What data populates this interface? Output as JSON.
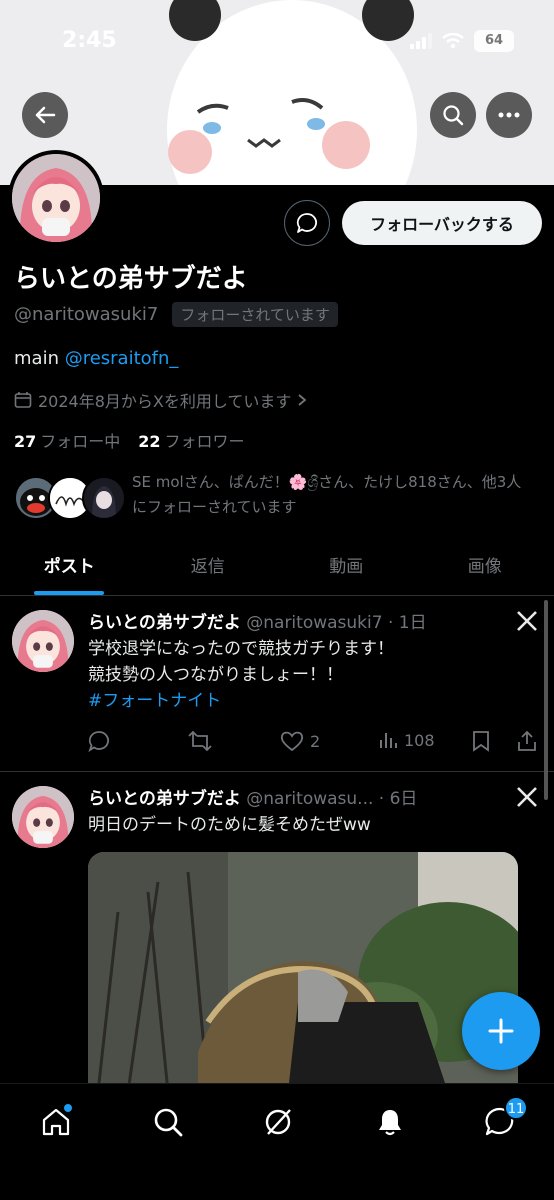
{
  "status_bar": {
    "time": "2:45",
    "battery": "64"
  },
  "profile": {
    "display_name": "らいとの弟サブだよ",
    "handle": "@naritowasuki7",
    "follows_you": "フォローされています",
    "bio_text": "main ",
    "bio_mention": "@resraitofn_",
    "joined": "2024年8月からXを利用しています",
    "following_count": "27",
    "following_label": "フォロー中",
    "followers_count": "22",
    "followers_label": "フォロワー",
    "followed_by_text": "SE molさん、ぱんだ！🌸ශ්‍රීさん、たけし818さん、他3人にフォローされています",
    "follow_back_label": "フォローバックする"
  },
  "tabs": [
    {
      "label": "ポスト",
      "active": true
    },
    {
      "label": "返信",
      "active": false
    },
    {
      "label": "動画",
      "active": false
    },
    {
      "label": "画像",
      "active": false
    }
  ],
  "posts": [
    {
      "name": "らいとの弟サブだよ",
      "meta": " @naritowasuki7 · 1日",
      "line1": "学校退学になったので競技ガチります！",
      "line2": "競技勢の人つながりましょー！！",
      "hashtag": "#フォートナイト",
      "likes": "2",
      "views": "108"
    },
    {
      "name": "らいとの弟サブだよ",
      "meta": " @naritowasu... · 6日",
      "line1": "明日のデートのために髪そめたぜww"
    }
  ],
  "bottom_nav": {
    "messages_badge": "11"
  },
  "colors": {
    "accent": "#1d9bf0",
    "background": "#000000",
    "muted": "#71767b"
  }
}
